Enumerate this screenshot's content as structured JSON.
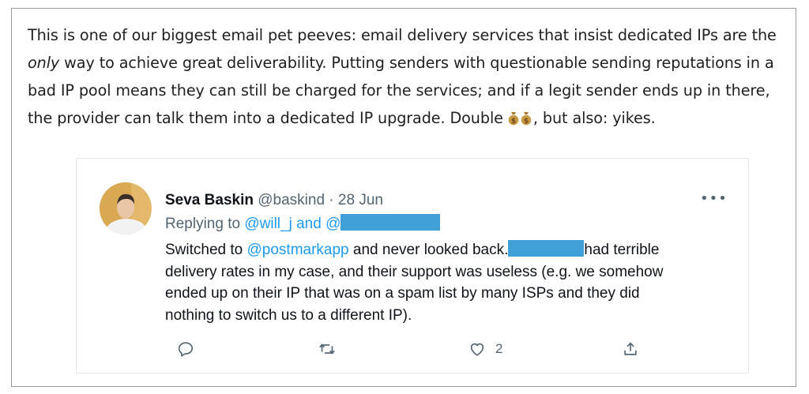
{
  "intro": {
    "line1": "This is one of our biggest email pet peeves: email delivery services that insist dedicated IPs are the",
    "line2_em": "only",
    "line2_rest": " way to achieve great deliverability. Putting senders with questionable sending reputations in a",
    "line3": "bad IP pool means they can still be charged for the services; and if a legit sender ends up in there,",
    "line4_a": "the provider can talk them into a dedicated IP upgrade. Double ",
    "line4_b": ", but also: yikes."
  },
  "tweet": {
    "author_name": "Seva Baskin",
    "author_handle": "@baskind",
    "separator": " · ",
    "date": "28 Jun",
    "more_label": "•••",
    "replying_prefix": "Replying to ",
    "replying_user": "@will_j",
    "replying_and": " and ",
    "replying_user2_visible": "@",
    "body_line1_a": "Switched to ",
    "body_line1_link": "@postmarkapp",
    "body_line1_b": " and never looked back.",
    "body_line1_c": "had terrible",
    "body_line2": "delivery rates in my case, and their support was useless (e.g. we somehow",
    "body_line3": "ended up on their IP that was on a spam list by many ISPs and they did",
    "body_line4": "nothing to switch us to a different IP).",
    "like_count": "2",
    "icons": [
      "reply-icon",
      "retweet-icon",
      "like-icon",
      "share-icon",
      "money-bag-icon"
    ],
    "colors": {
      "link": "#1d9bf0",
      "redaction": "#3fa1d8",
      "meta": "#536471"
    }
  }
}
